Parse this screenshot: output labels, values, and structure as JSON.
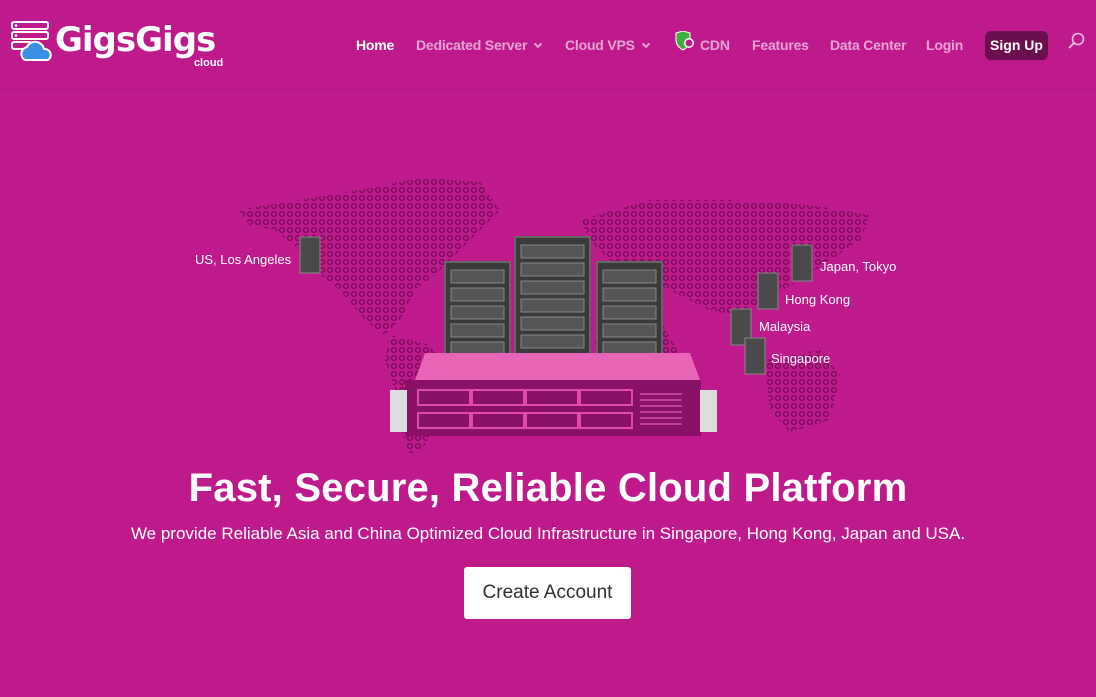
{
  "brand": {
    "name": "GigsGigs",
    "sub": "cloud"
  },
  "nav": {
    "home": "Home",
    "dedicated": "Dedicated Server",
    "cloud_vps": "Cloud VPS",
    "cdn": "CDN",
    "features": "Features",
    "datacenter": "Data Center",
    "login": "Login",
    "signup": "Sign Up"
  },
  "locations": {
    "la": "US, Los Angeles",
    "tokyo": "Japan, Tokyo",
    "hk": "Hong Kong",
    "my": "Malaysia",
    "sg": "Singapore"
  },
  "hero": {
    "title": "Fast, Secure, Reliable Cloud Platform",
    "subtitle": "We provide Reliable Asia and China Optimized Cloud Infrastructure in Singapore, Hong Kong, Japan and USA.",
    "cta": "Create Account"
  },
  "colors": {
    "background": "#bf1a8c",
    "signup_bg": "#6b0f4f",
    "map_dots": "#6e0d52",
    "shield": "#3fae3a"
  }
}
